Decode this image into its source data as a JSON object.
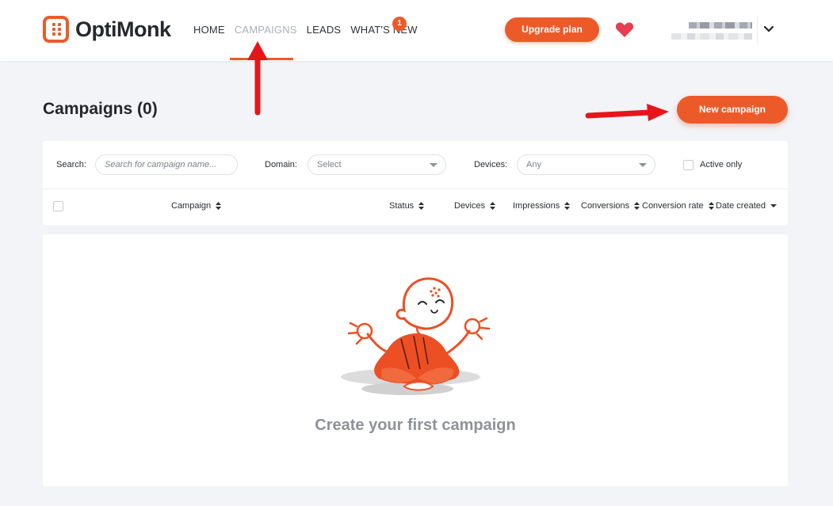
{
  "brand": {
    "name": "OptiMonk",
    "accent": "#ed5a29"
  },
  "nav": {
    "items": [
      {
        "label": "HOME",
        "active": false
      },
      {
        "label": "CAMPAIGNS",
        "active": true
      },
      {
        "label": "LEADS",
        "active": false
      },
      {
        "label": "WHAT'S NEW",
        "active": false
      }
    ],
    "badge": "1"
  },
  "header": {
    "upgrade_label": "Upgrade plan",
    "heart_icon": "heart-icon",
    "account_chevron_icon": "chevron-down-icon"
  },
  "page": {
    "title": "Campaigns (0)",
    "new_campaign_label": "New campaign"
  },
  "filters": {
    "search_label": "Search:",
    "search_placeholder": "Search for campaign name...",
    "domain_label": "Domain:",
    "domain_value": "Select",
    "devices_label": "Devices:",
    "devices_value": "Any",
    "active_only_label": "Active only"
  },
  "table": {
    "columns": [
      "Campaign",
      "Status",
      "Devices",
      "Impressions",
      "Conversions",
      "Conversion rate",
      "Date created"
    ]
  },
  "empty_state": {
    "text": "Create your first campaign",
    "illustration": "meditating-monk-illustration"
  }
}
